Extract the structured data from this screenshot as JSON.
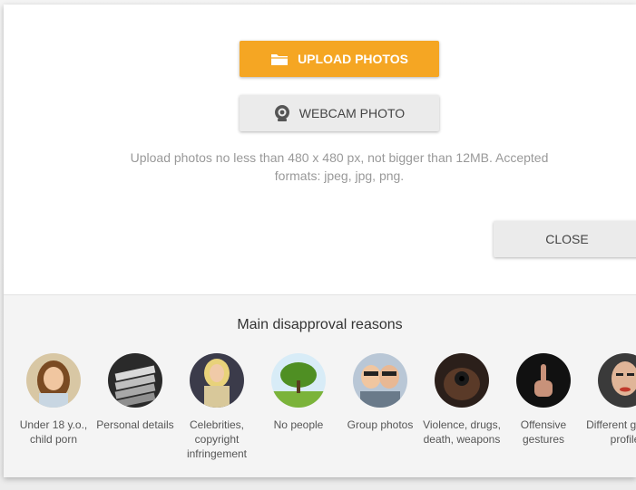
{
  "upload_button": {
    "label": "UPLOAD PHOTOS",
    "icon": "folder-icon"
  },
  "webcam_button": {
    "label": "WEBCAM PHOTO",
    "icon": "webcam-icon"
  },
  "hint": "Upload photos no less than 480 x 480 px, not bigger than 12MB. Accepted formats: jpeg, jpg, png.",
  "close_button": {
    "label": "CLOSE"
  },
  "reasons": {
    "title": "Main disapproval reasons",
    "items": [
      {
        "label": "Under 18 y.o., child porn"
      },
      {
        "label": "Personal details"
      },
      {
        "label": "Celebrities, copyright infringement"
      },
      {
        "label": "No people"
      },
      {
        "label": "Group photos"
      },
      {
        "label": "Violence, drugs, death, weapons"
      },
      {
        "label": "Offensive gestures"
      },
      {
        "label": "Different gender profile"
      }
    ]
  },
  "colors": {
    "accent": "#f5a623",
    "secondary_button": "#ebebeb"
  }
}
